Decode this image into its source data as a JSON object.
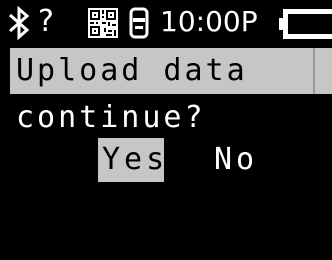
{
  "status_bar": {
    "icons": [
      "bluetooth-icon",
      "help-icon",
      "qr-code-icon",
      "scanner-icon",
      "battery-icon"
    ],
    "help_text": "?",
    "time": "10:00P"
  },
  "dialog": {
    "title": "Upload data",
    "prompt": "continue?",
    "yes_label": "Yes",
    "no_label": "No",
    "selected": "Yes"
  },
  "colors": {
    "background": "#000000",
    "foreground": "#ffffff",
    "highlight": "#c6c6c6"
  }
}
